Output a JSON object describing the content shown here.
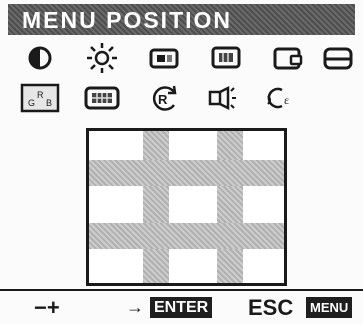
{
  "title": "MENU POSITION",
  "icons_row1": [
    "contrast-icon",
    "brightness-icon",
    "h-position-icon",
    "v-position-icon",
    "h-size-icon",
    "v-size-icon"
  ],
  "icons_row2": [
    "rgb-color-icon",
    "menu-position-icon",
    "recall-icon",
    "degauss-icon",
    "language-icon"
  ],
  "selected_icon": "rgb-color-icon",
  "footer": {
    "adjust_label": "−+",
    "enter_arrow": "→",
    "enter_label": "ENTER",
    "esc_label": "ESC",
    "menu_label": "MENU"
  },
  "colors": {
    "title_bg": "#5a5a5a",
    "text_dark": "#1a1a1a",
    "pattern_gray": "#bdbdbd"
  }
}
